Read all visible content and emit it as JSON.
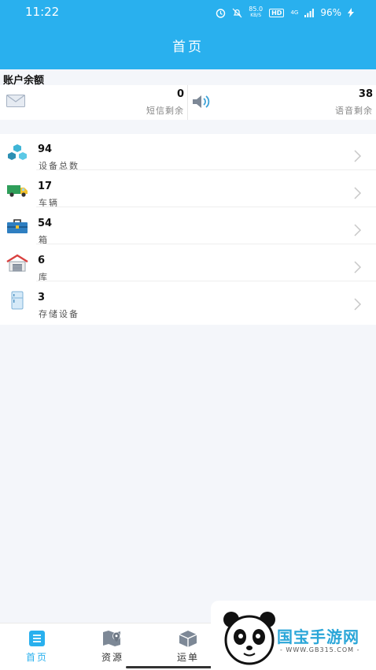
{
  "status": {
    "time": "11:22",
    "speed": "85.0",
    "speed_unit": "KB/S",
    "hd": "HD",
    "network": "4G",
    "battery": "96%"
  },
  "header": {
    "title": "首页"
  },
  "balance": {
    "title": "账户余额",
    "sms": {
      "value": "0",
      "label": "短信剩余",
      "icon": "envelope-icon"
    },
    "voice": {
      "value": "38",
      "label": "语音剩余",
      "icon": "speaker-icon"
    }
  },
  "list": {
    "items": [
      {
        "value": "94",
        "label": "设备总数",
        "icon": "cubes-icon"
      },
      {
        "value": "17",
        "label": "车辆",
        "icon": "truck-icon"
      },
      {
        "value": "54",
        "label": "箱",
        "icon": "toolbox-icon"
      },
      {
        "value": "6",
        "label": "库",
        "icon": "warehouse-icon"
      },
      {
        "value": "3",
        "label": "存储设备",
        "icon": "fridge-icon"
      }
    ]
  },
  "tabs": [
    {
      "label": "首页",
      "icon": "home-list-icon",
      "active": true
    },
    {
      "label": "资源",
      "icon": "map-pin-icon",
      "active": false
    },
    {
      "label": "运单",
      "icon": "package-icon",
      "active": false
    }
  ],
  "watermark": {
    "text": "国宝手游网",
    "sub": "- WWW.GB315.COM -"
  },
  "colors": {
    "primary": "#29b0ee",
    "background": "#f4f6fa"
  }
}
